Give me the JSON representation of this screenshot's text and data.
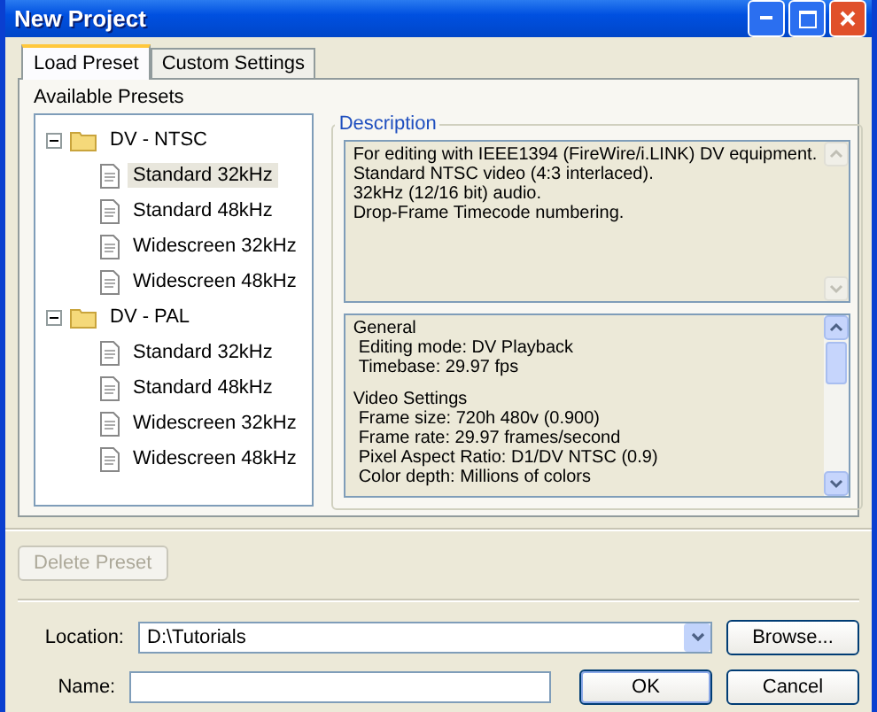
{
  "window": {
    "title": "New Project"
  },
  "tabs": [
    {
      "label": "Load Preset",
      "selected": true
    },
    {
      "label": "Custom Settings",
      "selected": false
    }
  ],
  "presets": {
    "label": "Available Presets",
    "tree": [
      {
        "label": "DV - NTSC",
        "expanded": true,
        "children": [
          {
            "label": "Standard 32kHz",
            "selected": true
          },
          {
            "label": "Standard 48kHz",
            "selected": false
          },
          {
            "label": "Widescreen 32kHz",
            "selected": false
          },
          {
            "label": "Widescreen 48kHz",
            "selected": false
          }
        ]
      },
      {
        "label": "DV - PAL",
        "expanded": true,
        "children": [
          {
            "label": "Standard 32kHz",
            "selected": false
          },
          {
            "label": "Standard 48kHz",
            "selected": false
          },
          {
            "label": "Widescreen 32kHz",
            "selected": false
          },
          {
            "label": "Widescreen 48kHz",
            "selected": false
          }
        ]
      }
    ]
  },
  "description": {
    "label": "Description",
    "lines": [
      "For editing with IEEE1394 (FireWire/i.LINK) DV equipment.",
      "Standard NTSC video (4:3 interlaced).",
      "32kHz (12/16 bit) audio.",
      "Drop-Frame Timecode numbering."
    ]
  },
  "details": [
    {
      "heading": "General",
      "lines": [
        "Editing mode: DV Playback",
        "Timebase: 29.97 fps"
      ]
    },
    {
      "heading": "Video Settings",
      "lines": [
        "Frame size: 720h 480v (0.900)",
        "Frame rate: 29.97 frames/second",
        "Pixel Aspect Ratio: D1/DV NTSC (0.9)",
        "Color depth: Millions of colors"
      ]
    }
  ],
  "delete_button": {
    "label": "Delete Preset",
    "disabled": true
  },
  "location": {
    "label": "Location:",
    "value": "D:\\Tutorials"
  },
  "browse_button": "Browse...",
  "name": {
    "label": "Name:"
  },
  "buttons": [
    {
      "label": "OK",
      "default": true
    },
    {
      "label": "Cancel",
      "default": false
    }
  ]
}
